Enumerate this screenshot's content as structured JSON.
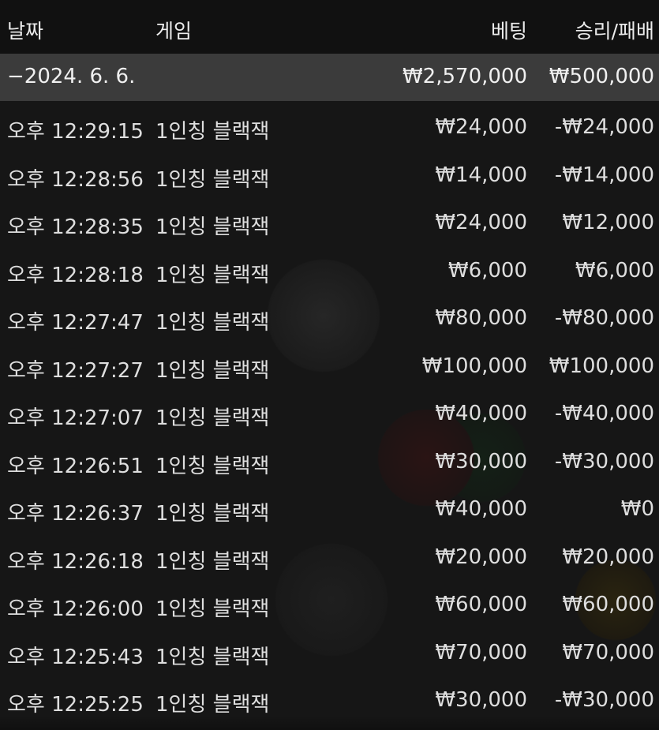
{
  "header": {
    "date_label": "날짜",
    "game_label": "게임",
    "bet_label": "베팅",
    "result_label": "승리/패배"
  },
  "date_group": {
    "date": "−2024. 6. 6.",
    "total_bet": "₩2,570,000",
    "total_result": "₩500,000"
  },
  "rows": [
    {
      "time": "오후 12:29:15",
      "game": "1인칭 블랙잭",
      "bet": "₩24,000",
      "result": "-₩24,000"
    },
    {
      "time": "오후 12:28:56",
      "game": "1인칭 블랙잭",
      "bet": "₩14,000",
      "result": "-₩14,000"
    },
    {
      "time": "오후 12:28:35",
      "game": "1인칭 블랙잭",
      "bet": "₩24,000",
      "result": "₩12,000"
    },
    {
      "time": "오후 12:28:18",
      "game": "1인칭 블랙잭",
      "bet": "₩6,000",
      "result": "₩6,000"
    },
    {
      "time": "오후 12:27:47",
      "game": "1인칭 블랙잭",
      "bet": "₩80,000",
      "result": "-₩80,000"
    },
    {
      "time": "오후 12:27:27",
      "game": "1인칭 블랙잭",
      "bet": "₩100,000",
      "result": "₩100,000"
    },
    {
      "time": "오후 12:27:07",
      "game": "1인칭 블랙잭",
      "bet": "₩40,000",
      "result": "-₩40,000"
    },
    {
      "time": "오후 12:26:51",
      "game": "1인칭 블랙잭",
      "bet": "₩30,000",
      "result": "-₩30,000"
    },
    {
      "time": "오후 12:26:37",
      "game": "1인칭 블랙잭",
      "bet": "₩40,000",
      "result": "₩0"
    },
    {
      "time": "오후 12:26:18",
      "game": "1인칭 블랙잭",
      "bet": "₩20,000",
      "result": "₩20,000"
    },
    {
      "time": "오후 12:26:00",
      "game": "1인칭 블랙잭",
      "bet": "₩60,000",
      "result": "₩60,000"
    },
    {
      "time": "오후 12:25:43",
      "game": "1인칭 블랙잭",
      "bet": "₩70,000",
      "result": "₩70,000"
    },
    {
      "time": "오후 12:25:25",
      "game": "1인칭 블랙잭",
      "bet": "₩30,000",
      "result": "-₩30,000"
    }
  ]
}
